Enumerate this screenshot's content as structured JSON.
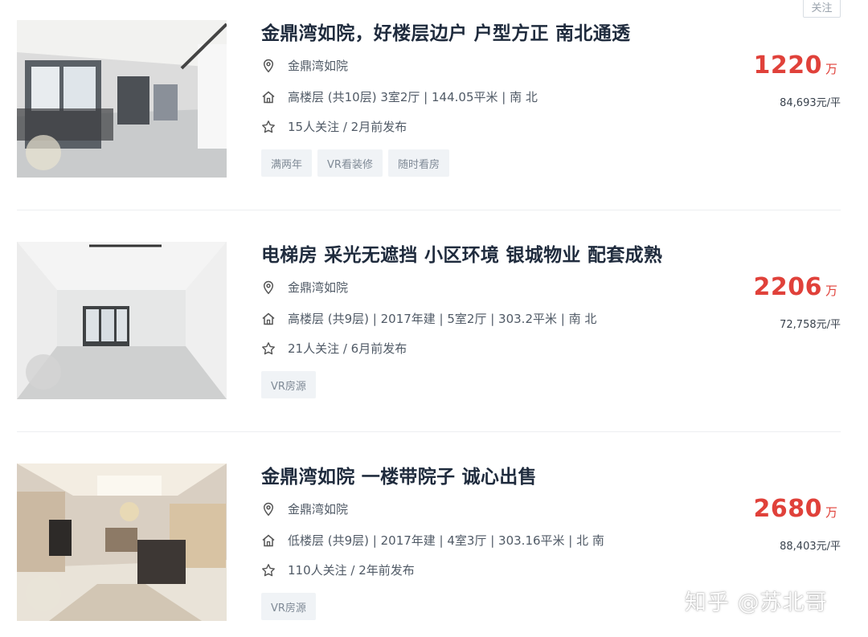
{
  "header": {
    "follow_label": "关注"
  },
  "listings": [
    {
      "title": "金鼎湾如院，好楼层边户 户型方正 南北通透",
      "community": "金鼎湾如院",
      "house_info": "高楼层 (共10层) 3室2厅 | 144.05平米 | 南 北",
      "follow_info": "15人关注 / 2月前发布",
      "tags": [
        "满两年",
        "VR看装修",
        "随时看房"
      ],
      "total_price": "1220",
      "price_unit": "万",
      "unit_price": "84,693元/平"
    },
    {
      "title": "电梯房 采光无遮挡 小区环境 银城物业 配套成熟",
      "community": "金鼎湾如院",
      "house_info": "高楼层 (共9层) | 2017年建 | 5室2厅 | 303.2平米 | 南 北",
      "follow_info": "21人关注 / 6月前发布",
      "tags": [
        "VR房源"
      ],
      "total_price": "2206",
      "price_unit": "万",
      "unit_price": "72,758元/平"
    },
    {
      "title": "金鼎湾如院 一楼带院子 诚心出售",
      "community": "金鼎湾如院",
      "house_info": "低楼层 (共9层) | 2017年建 | 4室3厅 | 303.16平米 | 北 南",
      "follow_info": "110人关注 / 2年前发布",
      "tags": [
        "VR房源"
      ],
      "total_price": "2680",
      "price_unit": "万",
      "unit_price": "88,403元/平"
    }
  ],
  "watermark": "知乎 @苏北哥",
  "colors": {
    "price": "#e0413a",
    "title": "#1f2b3d",
    "tag_bg": "#f0f3f6"
  }
}
